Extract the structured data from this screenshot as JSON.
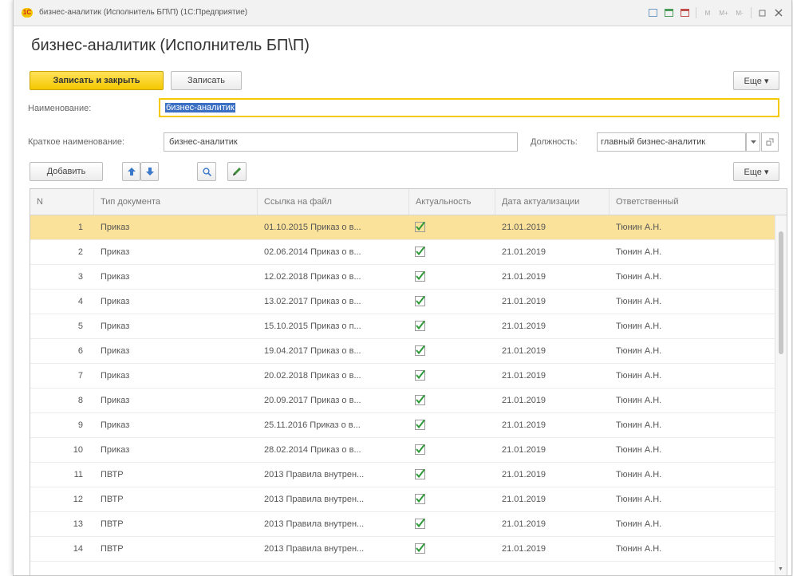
{
  "window": {
    "title": "бизнес-аналитик (Исполнитель БП\\П) (1С:Предприятие)",
    "logo_text": "1С"
  },
  "form": {
    "title": "бизнес-аналитик (Исполнитель БП\\П)"
  },
  "toolbar": {
    "save_close_label": "Записать и закрыть",
    "save_label": "Записать",
    "more_label": "Еще ▾"
  },
  "fields": {
    "name_label": "Наименование:",
    "name_value": "бизнес-аналитик",
    "short_name_label": "Краткое наименование:",
    "short_name_value": "бизнес-аналитик",
    "position_label": "Должность:",
    "position_value": "главный бизнес-аналитик"
  },
  "table_toolbar": {
    "add_label": "Добавить",
    "more_label": "Еще ▾"
  },
  "table": {
    "columns": [
      "N",
      "Тип документа",
      "Ссылка на файл",
      "Актуальность",
      "Дата актуализации",
      "Ответственный"
    ],
    "rows": [
      {
        "n": "1",
        "type": "Приказ",
        "link": "01.10.2015 Приказ о в...",
        "actual": true,
        "date": "21.01.2019",
        "resp": "Тюнин А.Н."
      },
      {
        "n": "2",
        "type": "Приказ",
        "link": "02.06.2014 Приказ о в...",
        "actual": true,
        "date": "21.01.2019",
        "resp": "Тюнин А.Н."
      },
      {
        "n": "3",
        "type": "Приказ",
        "link": "12.02.2018 Приказ о в...",
        "actual": true,
        "date": "21.01.2019",
        "resp": "Тюнин А.Н."
      },
      {
        "n": "4",
        "type": "Приказ",
        "link": "13.02.2017 Приказ о в...",
        "actual": true,
        "date": "21.01.2019",
        "resp": "Тюнин А.Н."
      },
      {
        "n": "5",
        "type": "Приказ",
        "link": "15.10.2015 Приказ о п...",
        "actual": true,
        "date": "21.01.2019",
        "resp": "Тюнин А.Н."
      },
      {
        "n": "6",
        "type": "Приказ",
        "link": "19.04.2017 Приказ о в...",
        "actual": true,
        "date": "21.01.2019",
        "resp": "Тюнин А.Н."
      },
      {
        "n": "7",
        "type": "Приказ",
        "link": "20.02.2018 Приказ о в...",
        "actual": true,
        "date": "21.01.2019",
        "resp": "Тюнин А.Н."
      },
      {
        "n": "8",
        "type": "Приказ",
        "link": "20.09.2017 Приказ о в...",
        "actual": true,
        "date": "21.01.2019",
        "resp": "Тюнин А.Н."
      },
      {
        "n": "9",
        "type": "Приказ",
        "link": "25.11.2016 Приказ о в...",
        "actual": true,
        "date": "21.01.2019",
        "resp": "Тюнин А.Н."
      },
      {
        "n": "10",
        "type": "Приказ",
        "link": "28.02.2014 Приказ о в...",
        "actual": true,
        "date": "21.01.2019",
        "resp": "Тюнин А.Н."
      },
      {
        "n": "11",
        "type": "ПВТР",
        "link": "2013 Правила внутрен...",
        "actual": true,
        "date": "21.01.2019",
        "resp": "Тюнин А.Н."
      },
      {
        "n": "12",
        "type": "ПВТР",
        "link": "2013 Правила внутрен...",
        "actual": true,
        "date": "21.01.2019",
        "resp": "Тюнин А.Н."
      },
      {
        "n": "13",
        "type": "ПВТР",
        "link": "2013 Правила внутрен...",
        "actual": true,
        "date": "21.01.2019",
        "resp": "Тюнин А.Н."
      },
      {
        "n": "14",
        "type": "ПВТР",
        "link": "2013 Правила внутрен...",
        "actual": true,
        "date": "21.01.2019",
        "resp": "Тюнин А.Н."
      }
    ],
    "selected_row": 0
  },
  "colors": {
    "accent_yellow": "#f5c800",
    "selected_row": "#fbe29a",
    "check_green": "#2f9a3a",
    "arrow_blue": "#3b78c9"
  }
}
